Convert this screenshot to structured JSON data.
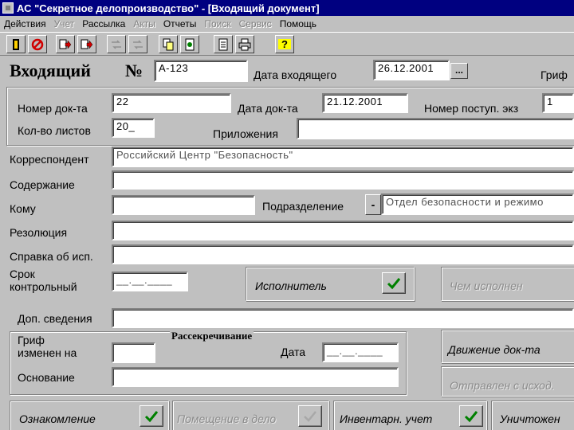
{
  "window": {
    "title": "АС \"Секретное делопроизводство\" - [Входящий документ]"
  },
  "menu": [
    {
      "label": "Действия",
      "enabled": true
    },
    {
      "label": "Учет",
      "enabled": false
    },
    {
      "label": "Рассылка",
      "enabled": true
    },
    {
      "label": "Акты",
      "enabled": false
    },
    {
      "label": "Отчеты",
      "enabled": true
    },
    {
      "label": "Поиск",
      "enabled": false
    },
    {
      "label": "Сервис",
      "enabled": false
    },
    {
      "label": "Помощь",
      "enabled": true
    }
  ],
  "toolbar": {
    "icons": [
      "exit-icon",
      "cancel-icon",
      "forward-icon",
      "forward-all-icon",
      "move-disabled-icon",
      "move-all-disabled-icon",
      "copy-icon",
      "document-icon",
      "preview-icon",
      "print-icon",
      "help-icon"
    ],
    "help_label": "?"
  },
  "header": {
    "title": "Входящий",
    "number_sign": "№",
    "number_value": "А-123",
    "incoming_date_label": "Дата входящего",
    "incoming_date_value": "26.12.2001",
    "dots_label": "...",
    "grif_label": "Гриф"
  },
  "doc_group": {
    "doc_number_label": "Номер док-та",
    "doc_number_value": "22",
    "doc_date_label": "Дата док-та",
    "doc_date_value": "21.12.2001",
    "copy_number_label": "Номер поступ. экз",
    "copy_number_value": "1",
    "sheets_label": "Кол-во  листов",
    "sheets_value": "20_",
    "attachments_label": "Приложения",
    "attachments_value": ""
  },
  "fields": {
    "correspondent_label": "Корреспондент",
    "correspondent_value": "Российский Центр \"Безопасность\"",
    "content_label": "Содержание",
    "content_value": "",
    "to_label": "Кому",
    "to_value": "",
    "division_label": "Подразделение",
    "division_button": "-",
    "division_value": "Отдел безопасности и режимо",
    "resolution_label": "Резолюция",
    "resolution_value": "",
    "exec_note_label": "Справка об исп.",
    "exec_note_value": "",
    "deadline_label_1": "Срок",
    "deadline_label_2": "контрольный",
    "deadline_value": "__.__.____",
    "executor_label": "Исполнитель",
    "executed_by_label": "Чем исполнен",
    "extra_info_label": "Доп. сведения",
    "extra_info_value": ""
  },
  "declass": {
    "group_title": "Рассекречивание",
    "grif_changed_label_1": "Гриф",
    "grif_changed_label_2": "изменен на",
    "grif_changed_value": "",
    "date_label": "Дата",
    "date_value": "__.__.____",
    "basis_label": "Основание",
    "basis_value": "",
    "movement_label": "Движение док-та",
    "sent_label": "Отправлен с исход."
  },
  "bottom": {
    "familiarization_label": "Ознакомление",
    "filed_label": "Помещение в дело",
    "inventory_label": "Инвентарн. учет",
    "destruction_label": "Уничтожен"
  },
  "colors": {
    "title_bar": "#000080",
    "window": "#c0c0c0",
    "check": "#008000"
  }
}
